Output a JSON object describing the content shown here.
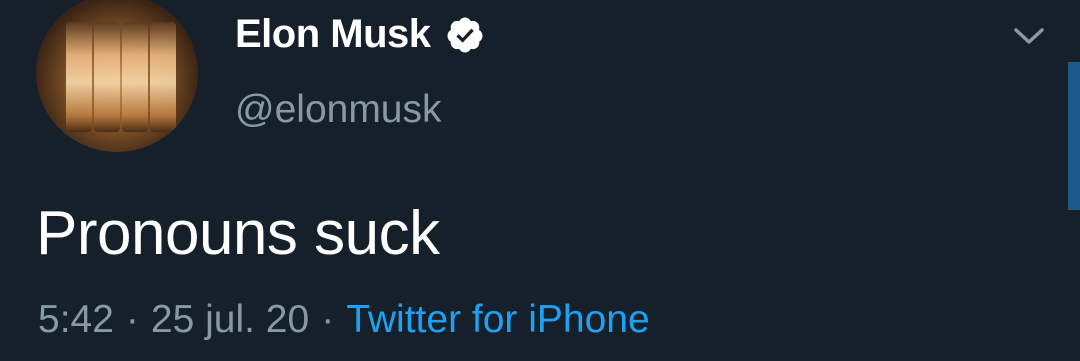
{
  "tweet": {
    "author_name": "Elon Musk",
    "handle": "@elonmusk",
    "text": "Pronouns suck",
    "time": "5:42",
    "date": "25 jul. 20",
    "separator": "·",
    "source": "Twitter for iPhone"
  },
  "icons": {
    "verified": "verified-badge-icon",
    "menu": "chevron-down-icon"
  },
  "colors": {
    "background": "#15202b",
    "primary_text": "#ffffff",
    "secondary_text": "#8899a6",
    "link": "#1da1f2"
  }
}
